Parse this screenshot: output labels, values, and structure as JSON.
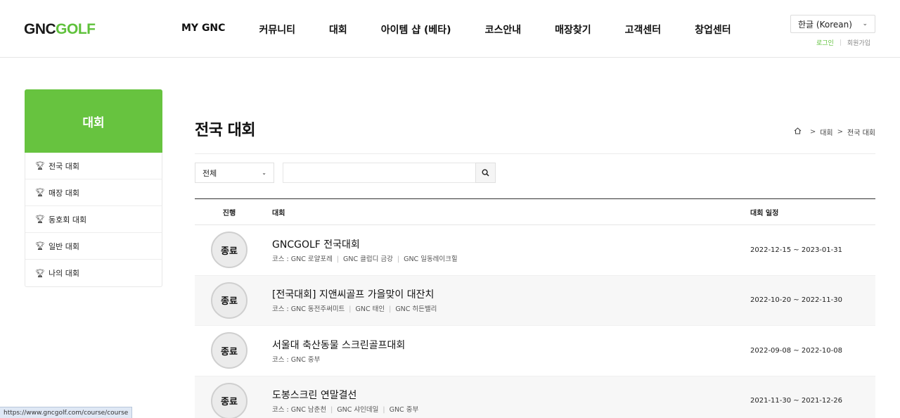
{
  "logo": {
    "part1": "GNC",
    "part2": "GOLF"
  },
  "nav": [
    "MY GNC",
    "커뮤니티",
    "대회",
    "아이템 샵 (베타)",
    "코스안내",
    "매장찾기",
    "고객센터",
    "창업센터"
  ],
  "language": {
    "selected": "한글 (Korean)"
  },
  "util": {
    "login": "로그인",
    "join": "회원가입"
  },
  "sidebar": {
    "title": "대회",
    "items": [
      "전국 대회",
      "매장 대회",
      "동호회 대회",
      "일반 대회",
      "나의 대회"
    ]
  },
  "page": {
    "title": "전국 대회"
  },
  "breadcrumb": [
    "대회",
    "전국 대회"
  ],
  "search": {
    "filter": "전체",
    "query": ""
  },
  "table": {
    "headers": {
      "status": "진행",
      "name": "대회",
      "date": "대회 일정"
    },
    "rows": [
      {
        "status": "종료",
        "title": "GNCGOLF 전국대회",
        "course_prefix": "코스 : ",
        "courses": [
          "GNC 로얄포레",
          "GNC 클럽디 금강",
          "GNC 일동레이크힐"
        ],
        "date": "2022-12-15 ~ 2023-01-31"
      },
      {
        "status": "종료",
        "title": "[전국대회] 지앤씨골프 가을맞이 대잔치",
        "course_prefix": "코스 : ",
        "courses": [
          "GNC 동전주써미트",
          "GNC 태인",
          "GNC 히든밸리"
        ],
        "date": "2022-10-20 ~ 2022-11-30"
      },
      {
        "status": "종료",
        "title": "서울대 축산동물 스크린골프대회",
        "course_prefix": "코스 : ",
        "courses": [
          "GNC 중부"
        ],
        "date": "2022-09-08 ~ 2022-10-08"
      },
      {
        "status": "종료",
        "title": "도봉스크린 연말결선",
        "course_prefix": "코스 : ",
        "courses": [
          "GNC 남춘천",
          "GNC 샤인데일",
          "GNC 중부"
        ],
        "date": "2021-11-30 ~ 2021-12-26"
      }
    ]
  },
  "statusbar": {
    "url": "https://www.gncgolf.com/course/course"
  },
  "icons": {
    "trophy": "trophy-icon",
    "home": "home-icon",
    "search": "search-icon",
    "chevron": "chevron-down-icon"
  },
  "colors": {
    "brand_green": "#67c33f",
    "login_green": "#5fc13b"
  }
}
